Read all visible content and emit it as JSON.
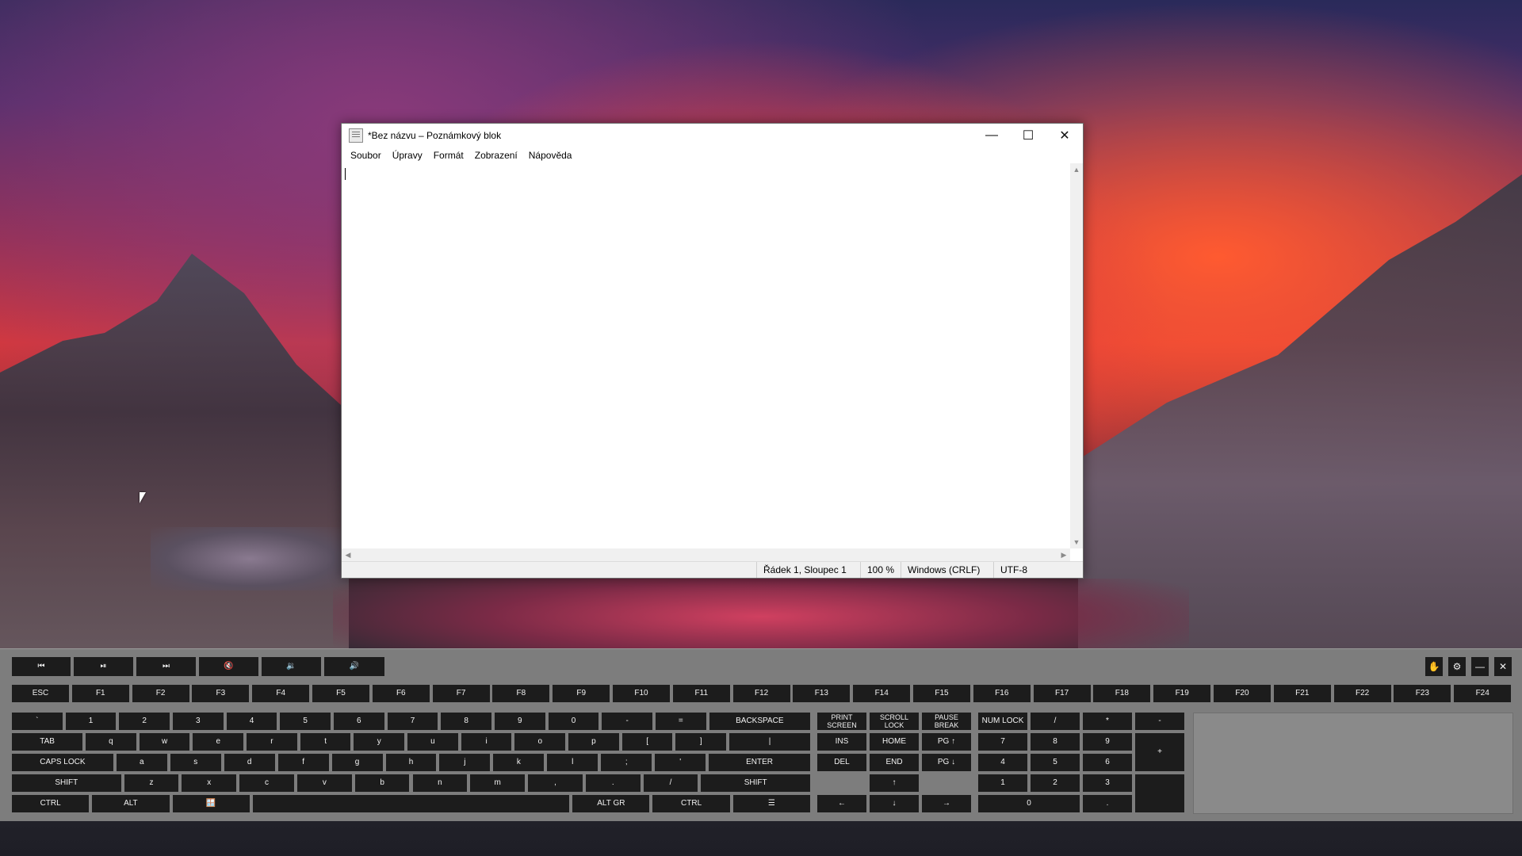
{
  "notepad": {
    "title": "*Bez názvu – Poznámkový blok",
    "menu": [
      "Soubor",
      "Úpravy",
      "Formát",
      "Zobrazení",
      "Nápověda"
    ],
    "controls": {
      "minimize": "—",
      "maximize": "☐",
      "close": "✕"
    },
    "status": {
      "position": "Řádek 1, Sloupec 1",
      "zoom": "100 %",
      "line_endings": "Windows (CRLF)",
      "encoding": "UTF-8"
    }
  },
  "keyboard": {
    "media": [
      "⏮",
      "⏯",
      "⏭",
      "🔇",
      "🔉",
      "🔊"
    ],
    "toolbar": [
      "✋",
      "⚙",
      "—",
      "✕"
    ],
    "row_fn": [
      "ESC",
      "F1",
      "F2",
      "F3",
      "F4",
      "F5",
      "F6",
      "F7",
      "F8",
      "F9",
      "F10",
      "F11",
      "F12",
      "F13",
      "F14",
      "F15",
      "F16",
      "F17",
      "F18",
      "F19",
      "F20",
      "F21",
      "F22",
      "F23",
      "F24"
    ],
    "row1": [
      "`",
      "1",
      "2",
      "3",
      "4",
      "5",
      "6",
      "7",
      "8",
      "9",
      "0",
      "-",
      "=",
      "BACKSPACE"
    ],
    "row2": [
      "TAB",
      "q",
      "w",
      "e",
      "r",
      "t",
      "y",
      "u",
      "i",
      "o",
      "p",
      "[",
      "]",
      "|"
    ],
    "row3": [
      "CAPS LOCK",
      "a",
      "s",
      "d",
      "f",
      "g",
      "h",
      "j",
      "k",
      "l",
      ";",
      "'",
      "ENTER"
    ],
    "row4": [
      "SHIFT",
      "z",
      "x",
      "c",
      "v",
      "b",
      "n",
      "m",
      ",",
      ".",
      "/",
      "SHIFT"
    ],
    "row5": [
      "CTRL",
      "ALT",
      "🪟",
      "",
      "ALT GR",
      "CTRL",
      "☰"
    ],
    "nav": {
      "print_screen": "PRINT\nSCREEN",
      "scroll_lock": "SCROLL\nLOCK",
      "pause_break": "PAUSE\nBREAK",
      "ins": "INS",
      "home": "HOME",
      "pgup": "PG ↑",
      "del": "DEL",
      "end": "END",
      "pgdn": "PG ↓",
      "up": "↑",
      "left": "←",
      "down": "↓",
      "right": "→"
    },
    "numpad": {
      "numlock": "NUM LOCK",
      "divide": "/",
      "multiply": "*",
      "minus": "-",
      "n7": "7",
      "n8": "8",
      "n9": "9",
      "plus": "+",
      "n4": "4",
      "n5": "5",
      "n6": "6",
      "n1": "1",
      "n2": "2",
      "n3": "3",
      "n0": "0",
      "dot": "."
    }
  }
}
